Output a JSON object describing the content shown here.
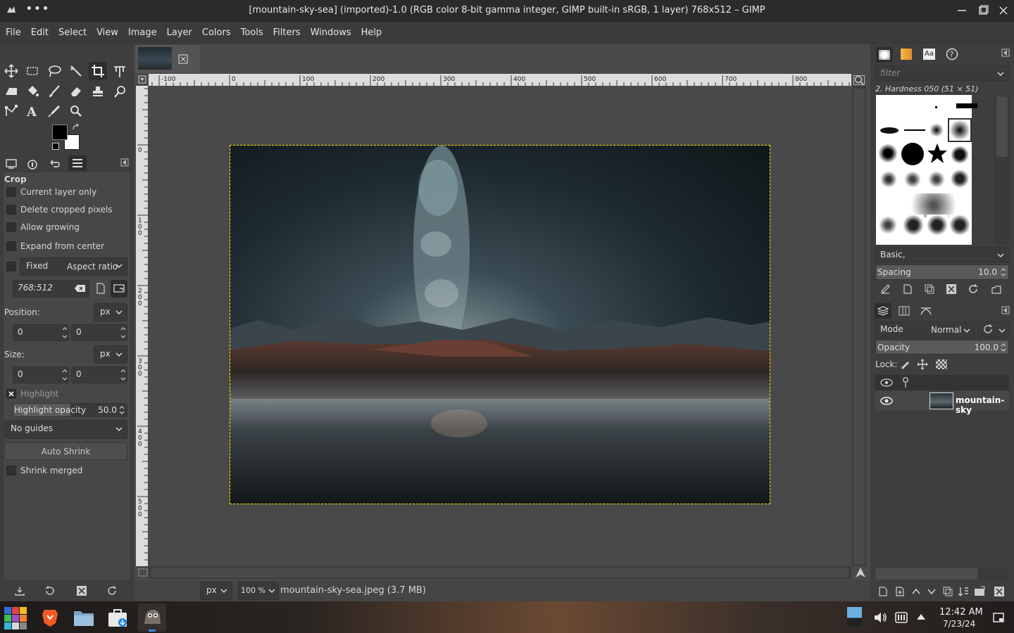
{
  "window": {
    "title": "[mountain-sky-sea] (imported)-1.0 (RGB color 8-bit gamma integer, GIMP built-in sRGB, 1 layer) 768x512 – GIMP"
  },
  "menubar": [
    "File",
    "Edit",
    "Select",
    "View",
    "Image",
    "Layer",
    "Colors",
    "Tools",
    "Filters",
    "Windows",
    "Help"
  ],
  "tool_options": {
    "title": "Crop",
    "current_layer_only": "Current layer only",
    "delete_cropped": "Delete cropped pixels",
    "allow_growing": "Allow growing",
    "expand_from_center": "Expand from center",
    "fixed": "Fixed",
    "fixed_mode": "Aspect ratio",
    "ratio_value": "768:512",
    "position_label": "Position:",
    "position_unit": "px",
    "position_x": "0",
    "position_y": "0",
    "size_label": "Size:",
    "size_unit": "px",
    "size_w": "0",
    "size_h": "0",
    "highlight": "Highlight",
    "highlight_opacity_label": "Highlight opacity",
    "highlight_opacity_value": "50.0",
    "highlight_opacity": 0.5,
    "guides": "No guides",
    "auto_shrink": "Auto Shrink",
    "shrink_merged": "Shrink merged"
  },
  "ruler_top": [
    "-100",
    "0",
    "100",
    "200",
    "300",
    "400",
    "500",
    "600",
    "700",
    "800"
  ],
  "ruler_left": [
    "0",
    "1\n0\n0",
    "2\n0\n0",
    "3\n0\n0",
    "4\n0\n0",
    "5\n0\n0"
  ],
  "statusbar": {
    "unit": "px",
    "zoom": "100 %",
    "file": "mountain-sky-sea.jpeg (3.7 MB)"
  },
  "brushes": {
    "filter_placeholder": "filter",
    "current": "2. Hardness 050 (51 × 51)",
    "preset": "Basic,",
    "spacing_label": "Spacing",
    "spacing_value": "10.0"
  },
  "layers": {
    "mode_label": "Mode",
    "mode_value": "Normal",
    "opacity_label": "Opacity",
    "opacity_value": "100.0",
    "opacity": 1.0,
    "lock_label": "Lock:",
    "layer_name": "mountain-sky"
  },
  "taskbar": {
    "time": "12:42 AM",
    "date": "7/23/24"
  },
  "colors": {
    "foreground": "#000000",
    "background": "#ffffff",
    "selection_outline": "#ffe400"
  }
}
